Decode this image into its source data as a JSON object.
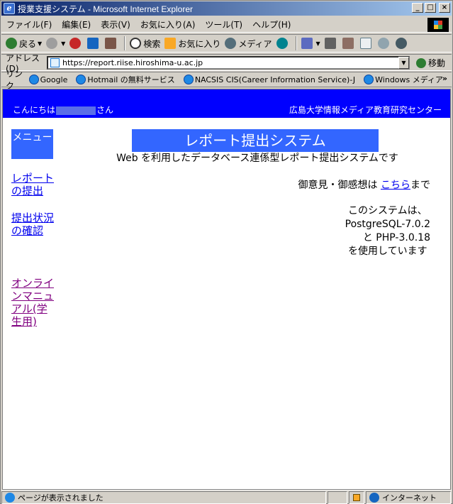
{
  "window": {
    "title": "授業支援システム - Microsoft Internet Explorer",
    "minimize": "_",
    "maximize": "□",
    "close": "×"
  },
  "menubar": {
    "items": [
      "ファイル(F)",
      "編集(E)",
      "表示(V)",
      "お気に入り(A)",
      "ツール(T)",
      "ヘルプ(H)"
    ]
  },
  "toolbar": {
    "back": "戻る",
    "search": "検索",
    "favorites": "お気に入り",
    "media": "メディア"
  },
  "address": {
    "label": "アドレス(D)",
    "url": "https://report.riise.hiroshima-u.ac.jp",
    "go": "移動"
  },
  "links": {
    "label": "リンク",
    "items": [
      "Google",
      "Hotmail の無料サービス",
      "NACSIS CIS(Career Information Service)-J",
      "Windows メディア"
    ],
    "more": "»"
  },
  "page": {
    "greeting_prefix": "こんにちは",
    "greeting_suffix": "さん",
    "center_name": "広島大学情報メディア教育研究センター",
    "menu_label": "メニュー",
    "side_links": [
      "レポートの提出",
      "提出状況の確認",
      "オンラインマニュアル(学生用)"
    ],
    "system_title": "レポート提出システム",
    "system_subtitle": "Web を利用したデータベース連係型レポート提出システムです",
    "feedback_prefix": "御意見・御感想は ",
    "feedback_link": "こちら",
    "feedback_suffix": "まで",
    "sysinfo_line1": "このシステムは、",
    "sysinfo_line2": "PostgreSQL-7.0.2",
    "sysinfo_line3": "と PHP-3.0.18",
    "sysinfo_line4": "を使用しています"
  },
  "status": {
    "message": "ページが表示されました",
    "zone": "インターネット"
  }
}
